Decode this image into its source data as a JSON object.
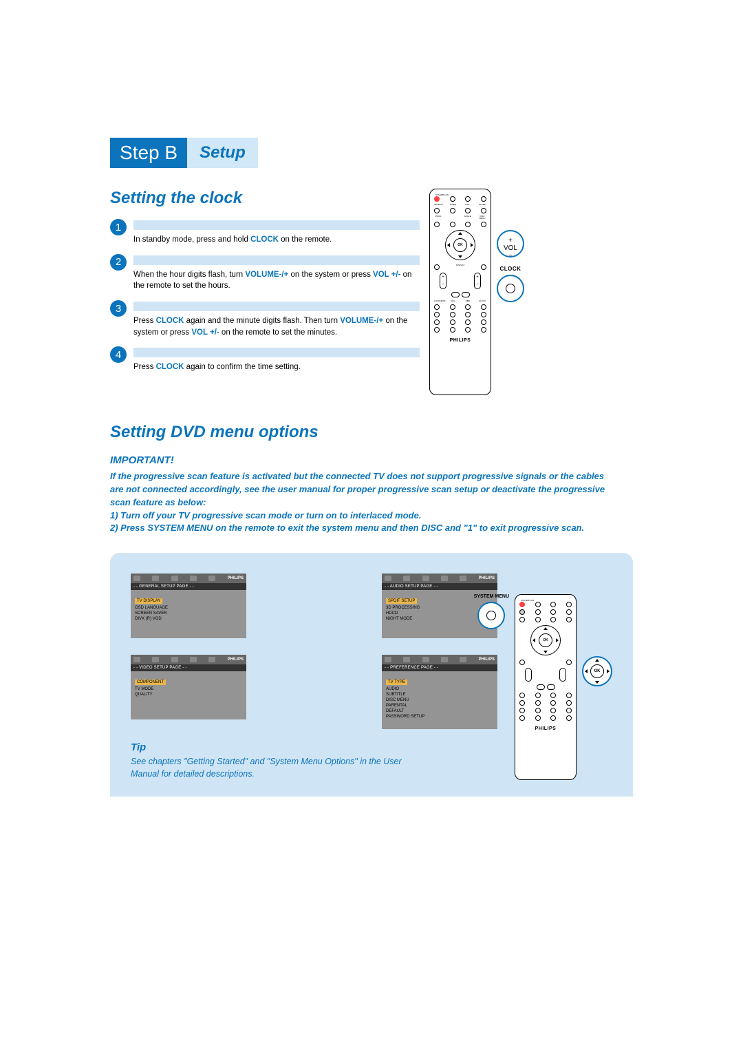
{
  "step": {
    "label": "Step B",
    "sub": "Setup"
  },
  "clock": {
    "title": "Setting the clock",
    "steps": [
      "In standby mode, press and hold <b>CLOCK</b> on the remote.",
      "When the hour digits flash, turn <b>VOLUME-/+</b> on the system or press <b>VOL +/-</b> on the remote to set the hours.",
      "Press <b>CLOCK</b> again and the minute digits flash. Then turn <b>VOLUME-/+</b> on the system or press <b>VOL +/-</b> on the remote to set the minutes.",
      "Press <b>CLOCK</b> again to confirm the time setting."
    ]
  },
  "callouts": {
    "vol": "VOL",
    "clock": "CLOCK",
    "sysmenu": "SYSTEM MENU",
    "ok": "OK"
  },
  "remote": {
    "row1_labels": [
      "STANDBY-ON",
      "",
      "",
      ""
    ],
    "row2_labels": [
      "SOURCE",
      "TIMER",
      "DSC",
      "SLEEP"
    ],
    "row3_labels": [
      "PROG",
      "",
      "ANGLE",
      "DISC MENU"
    ],
    "ok": "OK",
    "display": "DISPLAY",
    "trans_labels": [
      "LOUDNESS",
      "VEC",
      "DBB",
      "CLOCK"
    ],
    "brand": "PHILIPS"
  },
  "dvd": {
    "title": "Setting DVD menu options",
    "important_hdr": "IMPORTANT!",
    "important": "If the progressive scan feature is activated but the connected TV does not support progressive signals or the cables are not connected accordingly, see the user manual for proper progressive scan setup or deactivate the progressive scan feature as below:\n1) Turn off your TV progressive scan mode or turn on to interlaced mode.\n2) Press SYSTEM MENU on the remote to exit the system menu and then DISC and \"1\" to exit progressive scan."
  },
  "menus": {
    "brand": "PHILIPS",
    "general": {
      "title": "- - GENERAL SETUP PAGE - -",
      "items": [
        "TV DISPLAY",
        "OSD LANGUAGE",
        "SCREEN SAVER",
        "DIVX (R) VOD"
      ]
    },
    "audio": {
      "title": "- - AUDIO SETUP PAGE - -",
      "items": [
        "SPDIF SETUP",
        "3D PROCESSING",
        "HDCD",
        "NIGHT MODE"
      ]
    },
    "video": {
      "title": "- - VIDEO SETUP PAGE - -",
      "items": [
        "COMPONENT",
        "TV MODE",
        "QUALITY"
      ]
    },
    "preference": {
      "title": "- - PREFERENCE PAGE - -",
      "items": [
        "TV TYPE",
        "AUDIO",
        "SUBTITLE",
        "DISC MENU",
        "PARENTAL",
        "DEFAULT",
        "PASSWORD SETUP"
      ]
    }
  },
  "tip": {
    "hdr": "Tip",
    "text": "See chapters \"Getting Started\" and \"System Menu Options\" in the User Manual for detailed descriptions."
  }
}
